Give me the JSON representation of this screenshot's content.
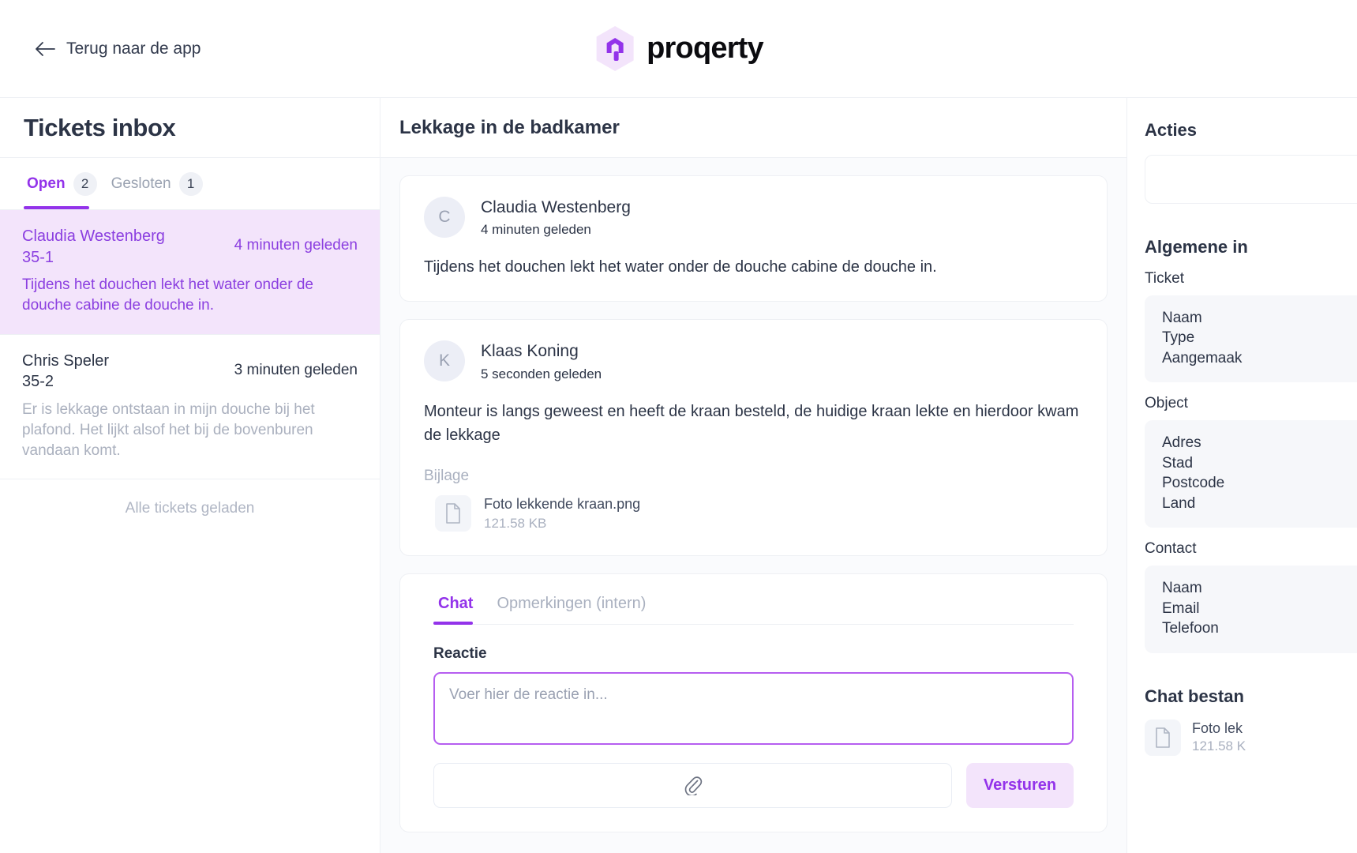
{
  "topbar": {
    "back_label": "Terug naar de app",
    "brand_name": "proqerty",
    "brand_accent": "#9333ea"
  },
  "inbox": {
    "title": "Tickets inbox",
    "tabs": [
      {
        "label": "Open",
        "count": "2",
        "active": true
      },
      {
        "label": "Gesloten",
        "count": "1",
        "active": false
      }
    ],
    "tickets": [
      {
        "name": "Claudia Westenberg",
        "ref": "35-1",
        "time": "4 minuten geleden",
        "preview": "Tijdens het douchen lekt het water onder de douche cabine de douche in.",
        "selected": true
      },
      {
        "name": "Chris Speler",
        "ref": "35-2",
        "time": "3 minuten geleden",
        "preview": "Er is lekkage ontstaan in mijn douche bij het plafond. Het lijkt alsof het bij de bovenburen vandaan komt.",
        "selected": false
      }
    ],
    "footer": "Alle tickets geladen"
  },
  "thread": {
    "title": "Lekkage in de badkamer",
    "messages": [
      {
        "initial": "C",
        "author": "Claudia Westenberg",
        "time": "4 minuten geleden",
        "text": "Tijdens het douchen lekt het water onder de douche cabine de douche in."
      },
      {
        "initial": "K",
        "author": "Klaas Koning",
        "time": "5 seconden geleden",
        "text": "Monteur is langs geweest en heeft de kraan besteld, de huidige kraan lekte en hierdoor kwam de lekkage",
        "attachment_label": "Bijlage",
        "attachment_name": "Foto lekkende kraan.png",
        "attachment_size": "121.58 KB"
      }
    ]
  },
  "composer": {
    "tabs": [
      {
        "label": "Chat",
        "active": true
      },
      {
        "label": "Opmerkingen (intern)",
        "active": false
      }
    ],
    "field_label": "Reactie",
    "reply_value": "",
    "reply_placeholder": "Voer hier de reactie in...",
    "attach_icon": "paperclip-icon",
    "send_label": "Versturen"
  },
  "aside": {
    "actions_heading": "Acties",
    "general_heading": "Algemene in",
    "ticket_label": "Ticket",
    "ticket_fields": [
      "Naam",
      "Type",
      "Aangemaak"
    ],
    "object_label": "Object",
    "object_fields": [
      "Adres",
      "Stad",
      "Postcode",
      "Land"
    ],
    "contact_label": "Contact",
    "contact_fields": [
      "Naam",
      "Email",
      "Telefoon"
    ],
    "files_heading": "Chat bestan",
    "file_name": "Foto lek",
    "file_size": "121.58 K"
  }
}
